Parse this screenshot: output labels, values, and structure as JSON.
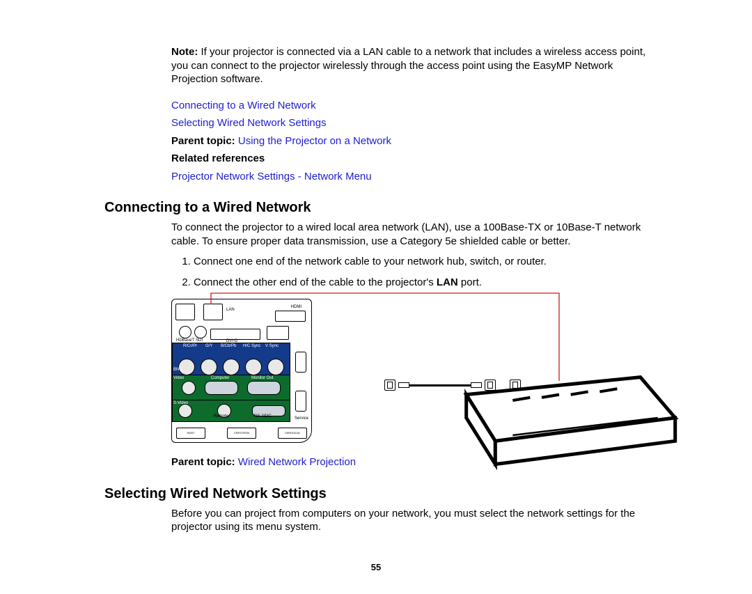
{
  "note": {
    "label": "Note:",
    "text": " If your projector is connected via a LAN cable to a network that includes a wireless access point, you can connect to the projector wirelessly through the access point using the EasyMP Network Projection software."
  },
  "links": {
    "connecting": "Connecting to a Wired Network",
    "selecting": "Selecting Wired Network Settings",
    "parent_topic_label": "Parent topic: ",
    "parent_topic_link1": "Using the Projector on a Network",
    "related_refs_heading": "Related references",
    "related_link": "Projector Network Settings - Network Menu",
    "parent_topic_link2": "Wired Network Projection"
  },
  "sections": {
    "s1": {
      "heading": "Connecting to a Wired Network",
      "intro": "To connect the projector to a wired local area network (LAN), use a 100Base-TX or 10Base-T network cable. To ensure proper data transmission, use a Category 5e shielded cable or better.",
      "step1": "Connect one end of the network cable to your network hub, switch, or router.",
      "step2_a": "Connect the other end of the cable to the projector's ",
      "step2_b": "LAN",
      "step2_c": " port."
    },
    "s2": {
      "heading": "Selecting Wired Network Settings",
      "intro": "Before you can project from computers on your network, you must select the network settings for the projector using its menu system."
    }
  },
  "panel_labels": {
    "lan": "LAN",
    "hdmi": "HDMI",
    "hdbaset": "HDBaseT",
    "sdi": "SDI",
    "dvid": "DVI-D",
    "rcypr": "R/Cr/Pr",
    "gy": "G/Y",
    "bcbpb": "B/Cb/Pb",
    "hcsync": "H/C Sync",
    "vsync": "V Sync",
    "bnc": "BNC",
    "video": "Video",
    "computer": "Computer",
    "monitorout": "Monitor Out",
    "svideo": "S-Video",
    "remote": "Remote",
    "rs232c": "RS-232C",
    "service": "Service",
    "hdbt": "HDBT",
    "crestron": "CRESTRON",
    "faroudja": "FAROUDJA"
  },
  "page_number": "55"
}
